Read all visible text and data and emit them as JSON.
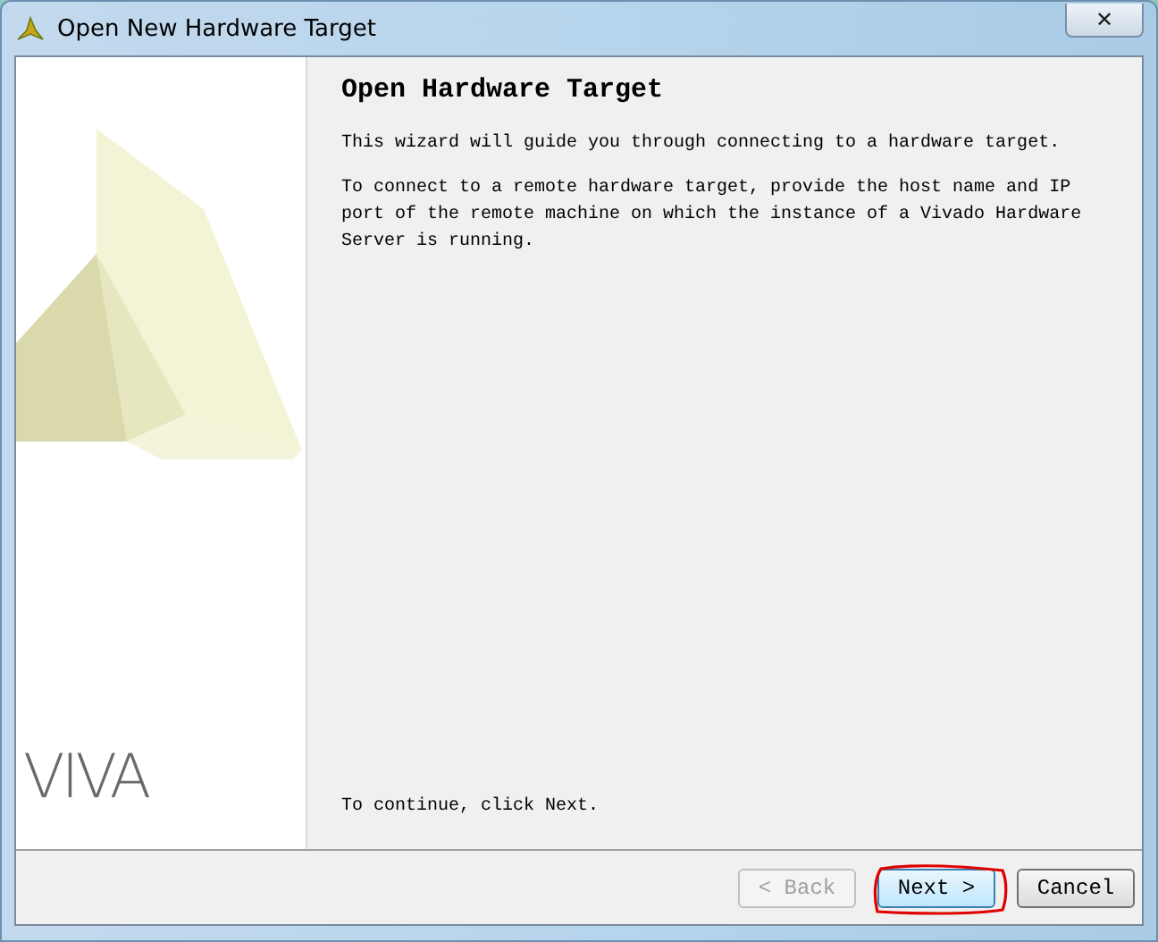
{
  "window": {
    "title": "Open New Hardware Target",
    "close": "✕"
  },
  "sidebar": {
    "logo_text": "VIVA"
  },
  "page": {
    "heading": "Open Hardware Target",
    "paragraphs": [
      "This wizard will guide you through connecting to a hardware target.",
      "To connect to a remote hardware target, provide the host name and IP port of the remote machine on which the instance of a Vivado Hardware Server is running."
    ],
    "footer": "To continue, click Next."
  },
  "buttons": [
    {
      "label": "< Back",
      "disabled": true,
      "annotated": false
    },
    {
      "label": "Next >",
      "disabled": false,
      "annotated": true
    },
    {
      "label": "Cancel",
      "disabled": false,
      "annotated": false
    }
  ]
}
